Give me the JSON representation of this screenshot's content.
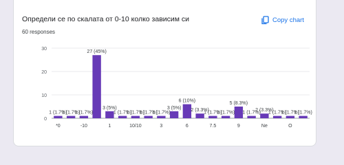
{
  "question": {
    "title": "Определи се по скалата от 0-10 колко зависим си",
    "responses": "60 responses"
  },
  "copy_chart": {
    "label": "Copy chart",
    "icon": "copy-icon"
  },
  "colors": {
    "bar": "#673ab7",
    "accent": "#1a73e8",
    "page_background": "#ebe9f2"
  },
  "chart_data": {
    "type": "bar",
    "title": "",
    "xlabel": "",
    "ylabel": "",
    "ylim": [
      0,
      30
    ],
    "yticks": [
      0,
      10,
      20,
      30
    ],
    "grid": true,
    "legend": "none",
    "values": [
      1,
      1,
      1,
      27,
      3,
      1,
      1,
      1,
      1,
      3,
      6,
      2,
      1,
      1,
      5,
      1,
      2,
      1,
      1,
      1
    ],
    "data_labels": [
      "1 (1.7%)",
      "1 (1.7%)",
      "1 (1.7%)",
      "27 (45%)",
      "3 (5%)",
      "1 (1.7%)",
      "1 (1.7%)",
      "1 (1.7%)",
      "1 (1.7%)",
      "3 (5%)",
      "6 (10%)",
      "2 (3.3%)",
      "1 (1.7%)",
      "1 (1.7%)",
      "5 (8.3%)",
      "1 (1.7%)",
      "2 (3.3%)",
      "1 (1.7%)",
      "1 (1.7%)",
      "1 (1.7%)"
    ],
    "visible_x_labels": [
      {
        "index": 0,
        "label": "*0"
      },
      {
        "index": 2,
        "label": "-10"
      },
      {
        "index": 4,
        "label": "1"
      },
      {
        "index": 6,
        "label": "10/10"
      },
      {
        "index": 8,
        "label": "3"
      },
      {
        "index": 10,
        "label": "6"
      },
      {
        "index": 12,
        "label": "7.5"
      },
      {
        "index": 14,
        "label": "9"
      },
      {
        "index": 16,
        "label": "Ne"
      },
      {
        "index": 18,
        "label": "O"
      }
    ]
  }
}
